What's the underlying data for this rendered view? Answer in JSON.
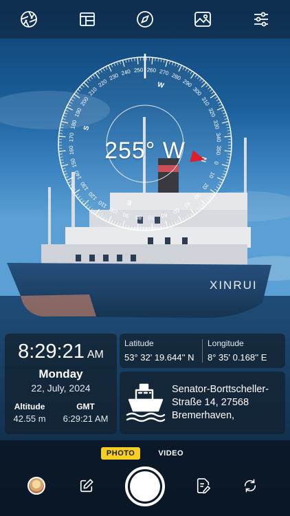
{
  "top_toolbar": {
    "icons": [
      "aperture-icon",
      "layout-icon",
      "compass-icon",
      "image-location-icon",
      "settings-sliders-icon"
    ]
  },
  "compass": {
    "heading_text": "255° W",
    "bearing_deg": 255,
    "direction_letters": [
      "N",
      "E",
      "S",
      "W"
    ],
    "accent_color": "#e21d2a"
  },
  "time_panel": {
    "time": "8:29:21",
    "ampm": "AM",
    "day": "Monday",
    "date": "22, July, 2024",
    "altitude_label": "Altitude",
    "altitude_value": "42.55 m",
    "gmt_label": "GMT",
    "gmt_value": "6:29:21 AM"
  },
  "coords_panel": {
    "latitude_label": "Latitude",
    "latitude_value": "53° 32' 19.644'' N",
    "longitude_label": "Longitude",
    "longitude_value": "8° 35' 0.168'' E"
  },
  "address_panel": {
    "address_lines": [
      "Senator-Borttscheller-",
      "Straße 14, 27568",
      "Bremerhaven,"
    ]
  },
  "photo": {
    "ship_name": "XINRUI"
  },
  "camera_bar": {
    "modes": [
      "PHOTO",
      "VIDEO"
    ],
    "active_mode": "PHOTO",
    "active_color": "#f6cf22"
  }
}
